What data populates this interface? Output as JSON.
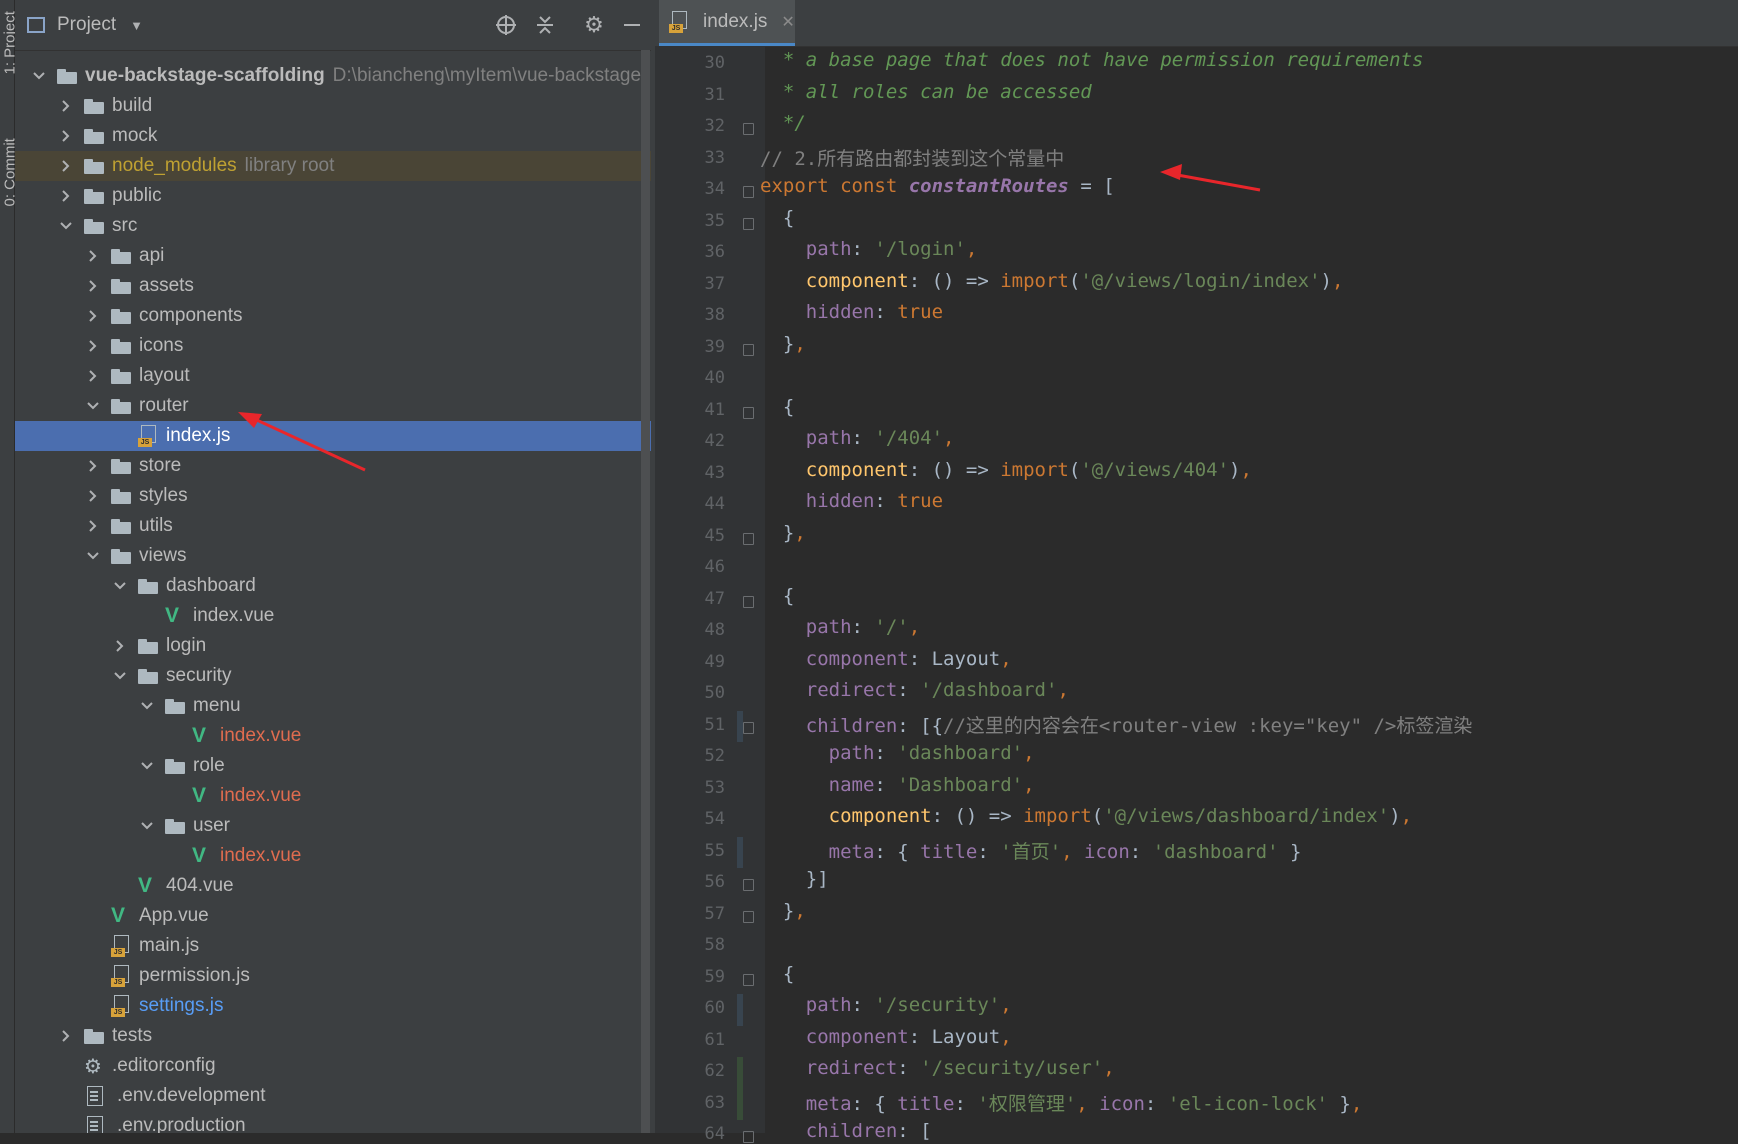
{
  "stripe": {
    "project_label": "1: Project",
    "commit_label": "0: Commit"
  },
  "project_panel": {
    "title": "Project",
    "tree": [
      {
        "label": "vue-backstage-scaffolding",
        "extra": "D:\\biancheng\\myItem\\vue-backstage-",
        "depth": 0,
        "type": "folder",
        "expanded": true,
        "bold": true
      },
      {
        "label": "build",
        "depth": 1,
        "type": "folder",
        "expanded": false
      },
      {
        "label": "mock",
        "depth": 1,
        "type": "folder",
        "expanded": false
      },
      {
        "label": "node_modules",
        "extra": "library root",
        "depth": 1,
        "type": "folder",
        "expanded": false,
        "style": "library"
      },
      {
        "label": "public",
        "depth": 1,
        "type": "folder",
        "expanded": false
      },
      {
        "label": "src",
        "depth": 1,
        "type": "folder",
        "expanded": true
      },
      {
        "label": "api",
        "depth": 2,
        "type": "folder",
        "expanded": false
      },
      {
        "label": "assets",
        "depth": 2,
        "type": "folder",
        "expanded": false
      },
      {
        "label": "components",
        "depth": 2,
        "type": "folder",
        "expanded": false
      },
      {
        "label": "icons",
        "depth": 2,
        "type": "folder",
        "expanded": false
      },
      {
        "label": "layout",
        "depth": 2,
        "type": "folder",
        "expanded": false
      },
      {
        "label": "router",
        "depth": 2,
        "type": "folder",
        "expanded": true
      },
      {
        "label": "index.js",
        "depth": 3,
        "type": "js",
        "selected": true
      },
      {
        "label": "store",
        "depth": 2,
        "type": "folder",
        "expanded": false
      },
      {
        "label": "styles",
        "depth": 2,
        "type": "folder",
        "expanded": false
      },
      {
        "label": "utils",
        "depth": 2,
        "type": "folder",
        "expanded": false
      },
      {
        "label": "views",
        "depth": 2,
        "type": "folder",
        "expanded": true
      },
      {
        "label": "dashboard",
        "depth": 3,
        "type": "folder",
        "expanded": true
      },
      {
        "label": "index.vue",
        "depth": 4,
        "type": "vue"
      },
      {
        "label": "login",
        "depth": 3,
        "type": "folder",
        "expanded": false
      },
      {
        "label": "security",
        "depth": 3,
        "type": "folder",
        "expanded": true
      },
      {
        "label": "menu",
        "depth": 4,
        "type": "folder",
        "expanded": true
      },
      {
        "label": "index.vue",
        "depth": 5,
        "type": "vue",
        "style": "modified"
      },
      {
        "label": "role",
        "depth": 4,
        "type": "folder",
        "expanded": true
      },
      {
        "label": "index.vue",
        "depth": 5,
        "type": "vue",
        "style": "modified"
      },
      {
        "label": "user",
        "depth": 4,
        "type": "folder",
        "expanded": true
      },
      {
        "label": "index.vue",
        "depth": 5,
        "type": "vue",
        "style": "modified"
      },
      {
        "label": "404.vue",
        "depth": 3,
        "type": "vue"
      },
      {
        "label": "App.vue",
        "depth": 2,
        "type": "vue"
      },
      {
        "label": "main.js",
        "depth": 2,
        "type": "js"
      },
      {
        "label": "permission.js",
        "depth": 2,
        "type": "js"
      },
      {
        "label": "settings.js",
        "depth": 2,
        "type": "js",
        "style": "changed"
      },
      {
        "label": "tests",
        "depth": 1,
        "type": "folder",
        "expanded": false
      },
      {
        "label": ".editorconfig",
        "depth": 1,
        "type": "config"
      },
      {
        "label": ".env.development",
        "depth": 1,
        "type": "file"
      },
      {
        "label": ".env.production",
        "depth": 1,
        "type": "file"
      }
    ]
  },
  "editor": {
    "tab_label": "index.js",
    "lines": [
      {
        "n": "30",
        "parts": [
          [
            "doc",
            "  * a base page that does not have permission requirements"
          ]
        ]
      },
      {
        "n": "31",
        "parts": [
          [
            "doc",
            "  * all roles can be accessed"
          ]
        ]
      },
      {
        "n": "32",
        "parts": [
          [
            "doc",
            "  */"
          ]
        ]
      },
      {
        "n": "33",
        "parts": [
          [
            "cmt",
            "// 2.所有路由都封装到这个常量中"
          ]
        ]
      },
      {
        "n": "34",
        "parts": [
          [
            "kw",
            "export const "
          ],
          [
            "italic-name",
            "constantRoutes"
          ],
          [
            "",
            " = ["
          ]
        ]
      },
      {
        "n": "35",
        "parts": [
          [
            "",
            "  {"
          ]
        ]
      },
      {
        "n": "36",
        "parts": [
          [
            "prop",
            "    path"
          ],
          [
            "",
            ": "
          ],
          [
            "str",
            "'/login'"
          ],
          [
            "kw",
            ","
          ]
        ]
      },
      {
        "n": "37",
        "parts": [
          [
            "fn",
            "    component"
          ],
          [
            "",
            ": () => "
          ],
          [
            "kw",
            "import"
          ],
          [
            "",
            "("
          ],
          [
            "str",
            "'@/views/login/index'"
          ],
          [
            "",
            ")"
          ],
          [
            "kw",
            ","
          ]
        ]
      },
      {
        "n": "38",
        "parts": [
          [
            "prop",
            "    hidden"
          ],
          [
            "",
            ": "
          ],
          [
            "kw",
            "true"
          ]
        ]
      },
      {
        "n": "39",
        "parts": [
          [
            "",
            "  }"
          ],
          [
            "kw",
            ","
          ]
        ]
      },
      {
        "n": "40",
        "parts": []
      },
      {
        "n": "41",
        "parts": [
          [
            "",
            "  {"
          ]
        ]
      },
      {
        "n": "42",
        "parts": [
          [
            "prop",
            "    path"
          ],
          [
            "",
            ": "
          ],
          [
            "str",
            "'/404'"
          ],
          [
            "kw",
            ","
          ]
        ]
      },
      {
        "n": "43",
        "parts": [
          [
            "fn",
            "    component"
          ],
          [
            "",
            ": () => "
          ],
          [
            "kw",
            "import"
          ],
          [
            "",
            "("
          ],
          [
            "str",
            "'@/views/404'"
          ],
          [
            "",
            ")"
          ],
          [
            "kw",
            ","
          ]
        ]
      },
      {
        "n": "44",
        "parts": [
          [
            "prop",
            "    hidden"
          ],
          [
            "",
            ": "
          ],
          [
            "kw",
            "true"
          ]
        ]
      },
      {
        "n": "45",
        "parts": [
          [
            "",
            "  }"
          ],
          [
            "kw",
            ","
          ]
        ]
      },
      {
        "n": "46",
        "parts": []
      },
      {
        "n": "47",
        "parts": [
          [
            "",
            "  {"
          ]
        ]
      },
      {
        "n": "48",
        "parts": [
          [
            "prop",
            "    path"
          ],
          [
            "",
            ": "
          ],
          [
            "str",
            "'/'"
          ],
          [
            "kw",
            ","
          ]
        ]
      },
      {
        "n": "49",
        "parts": [
          [
            "prop",
            "    component"
          ],
          [
            "",
            ": Layout"
          ],
          [
            "kw",
            ","
          ]
        ]
      },
      {
        "n": "50",
        "parts": [
          [
            "prop",
            "    redirect"
          ],
          [
            "",
            ": "
          ],
          [
            "str",
            "'/dashboard'"
          ],
          [
            "kw",
            ","
          ]
        ]
      },
      {
        "n": "51",
        "parts": [
          [
            "prop",
            "    children"
          ],
          [
            "",
            ": [{"
          ],
          [
            "cmt",
            "//这里的内容会在<router-view :key=\"key\" />标签渲染"
          ]
        ]
      },
      {
        "n": "52",
        "parts": [
          [
            "prop",
            "      path"
          ],
          [
            "",
            ": "
          ],
          [
            "str",
            "'dashboard'"
          ],
          [
            "kw",
            ","
          ]
        ]
      },
      {
        "n": "53",
        "parts": [
          [
            "prop",
            "      name"
          ],
          [
            "",
            ": "
          ],
          [
            "str",
            "'Dashboard'"
          ],
          [
            "kw",
            ","
          ]
        ]
      },
      {
        "n": "54",
        "parts": [
          [
            "fn",
            "      component"
          ],
          [
            "",
            ": () => "
          ],
          [
            "kw",
            "import"
          ],
          [
            "",
            "("
          ],
          [
            "str",
            "'@/views/dashboard/index'"
          ],
          [
            "",
            ")"
          ],
          [
            "kw",
            ","
          ]
        ]
      },
      {
        "n": "55",
        "parts": [
          [
            "prop",
            "      meta"
          ],
          [
            "",
            ": { "
          ],
          [
            "prop",
            "title"
          ],
          [
            "",
            ": "
          ],
          [
            "str",
            "'首页'"
          ],
          [
            "kw",
            ", "
          ],
          [
            "prop",
            "icon"
          ],
          [
            "",
            ": "
          ],
          [
            "str",
            "'dashboard'"
          ],
          [
            "",
            " }"
          ]
        ]
      },
      {
        "n": "56",
        "parts": [
          [
            "",
            "    }]"
          ]
        ]
      },
      {
        "n": "57",
        "parts": [
          [
            "",
            "  }"
          ],
          [
            "kw",
            ","
          ]
        ]
      },
      {
        "n": "58",
        "parts": []
      },
      {
        "n": "59",
        "parts": [
          [
            "",
            "  {"
          ]
        ]
      },
      {
        "n": "60",
        "parts": [
          [
            "prop",
            "    path"
          ],
          [
            "",
            ": "
          ],
          [
            "str",
            "'/security'"
          ],
          [
            "kw",
            ","
          ]
        ]
      },
      {
        "n": "61",
        "parts": [
          [
            "prop",
            "    component"
          ],
          [
            "",
            ": Layout"
          ],
          [
            "kw",
            ","
          ]
        ]
      },
      {
        "n": "62",
        "parts": [
          [
            "prop",
            "    redirect"
          ],
          [
            "",
            ": "
          ],
          [
            "str",
            "'/security/user'"
          ],
          [
            "kw",
            ","
          ]
        ]
      },
      {
        "n": "63",
        "parts": [
          [
            "prop",
            "    meta"
          ],
          [
            "",
            ": { "
          ],
          [
            "prop",
            "title"
          ],
          [
            "",
            ": "
          ],
          [
            "str",
            "'权限管理'"
          ],
          [
            "kw",
            ", "
          ],
          [
            "prop",
            "icon"
          ],
          [
            "",
            ": "
          ],
          [
            "str",
            "'el-icon-lock'"
          ],
          [
            "",
            " }"
          ],
          [
            "kw",
            ","
          ]
        ]
      },
      {
        "n": "64",
        "parts": [
          [
            "prop",
            "    children"
          ],
          [
            "",
            ": ["
          ]
        ]
      }
    ]
  },
  "colors": {
    "selection": "#4b6eaf",
    "annotation_arrow": "#e8262b",
    "keyword": "#cc7832",
    "string": "#6a8759",
    "property": "#9876aa"
  }
}
